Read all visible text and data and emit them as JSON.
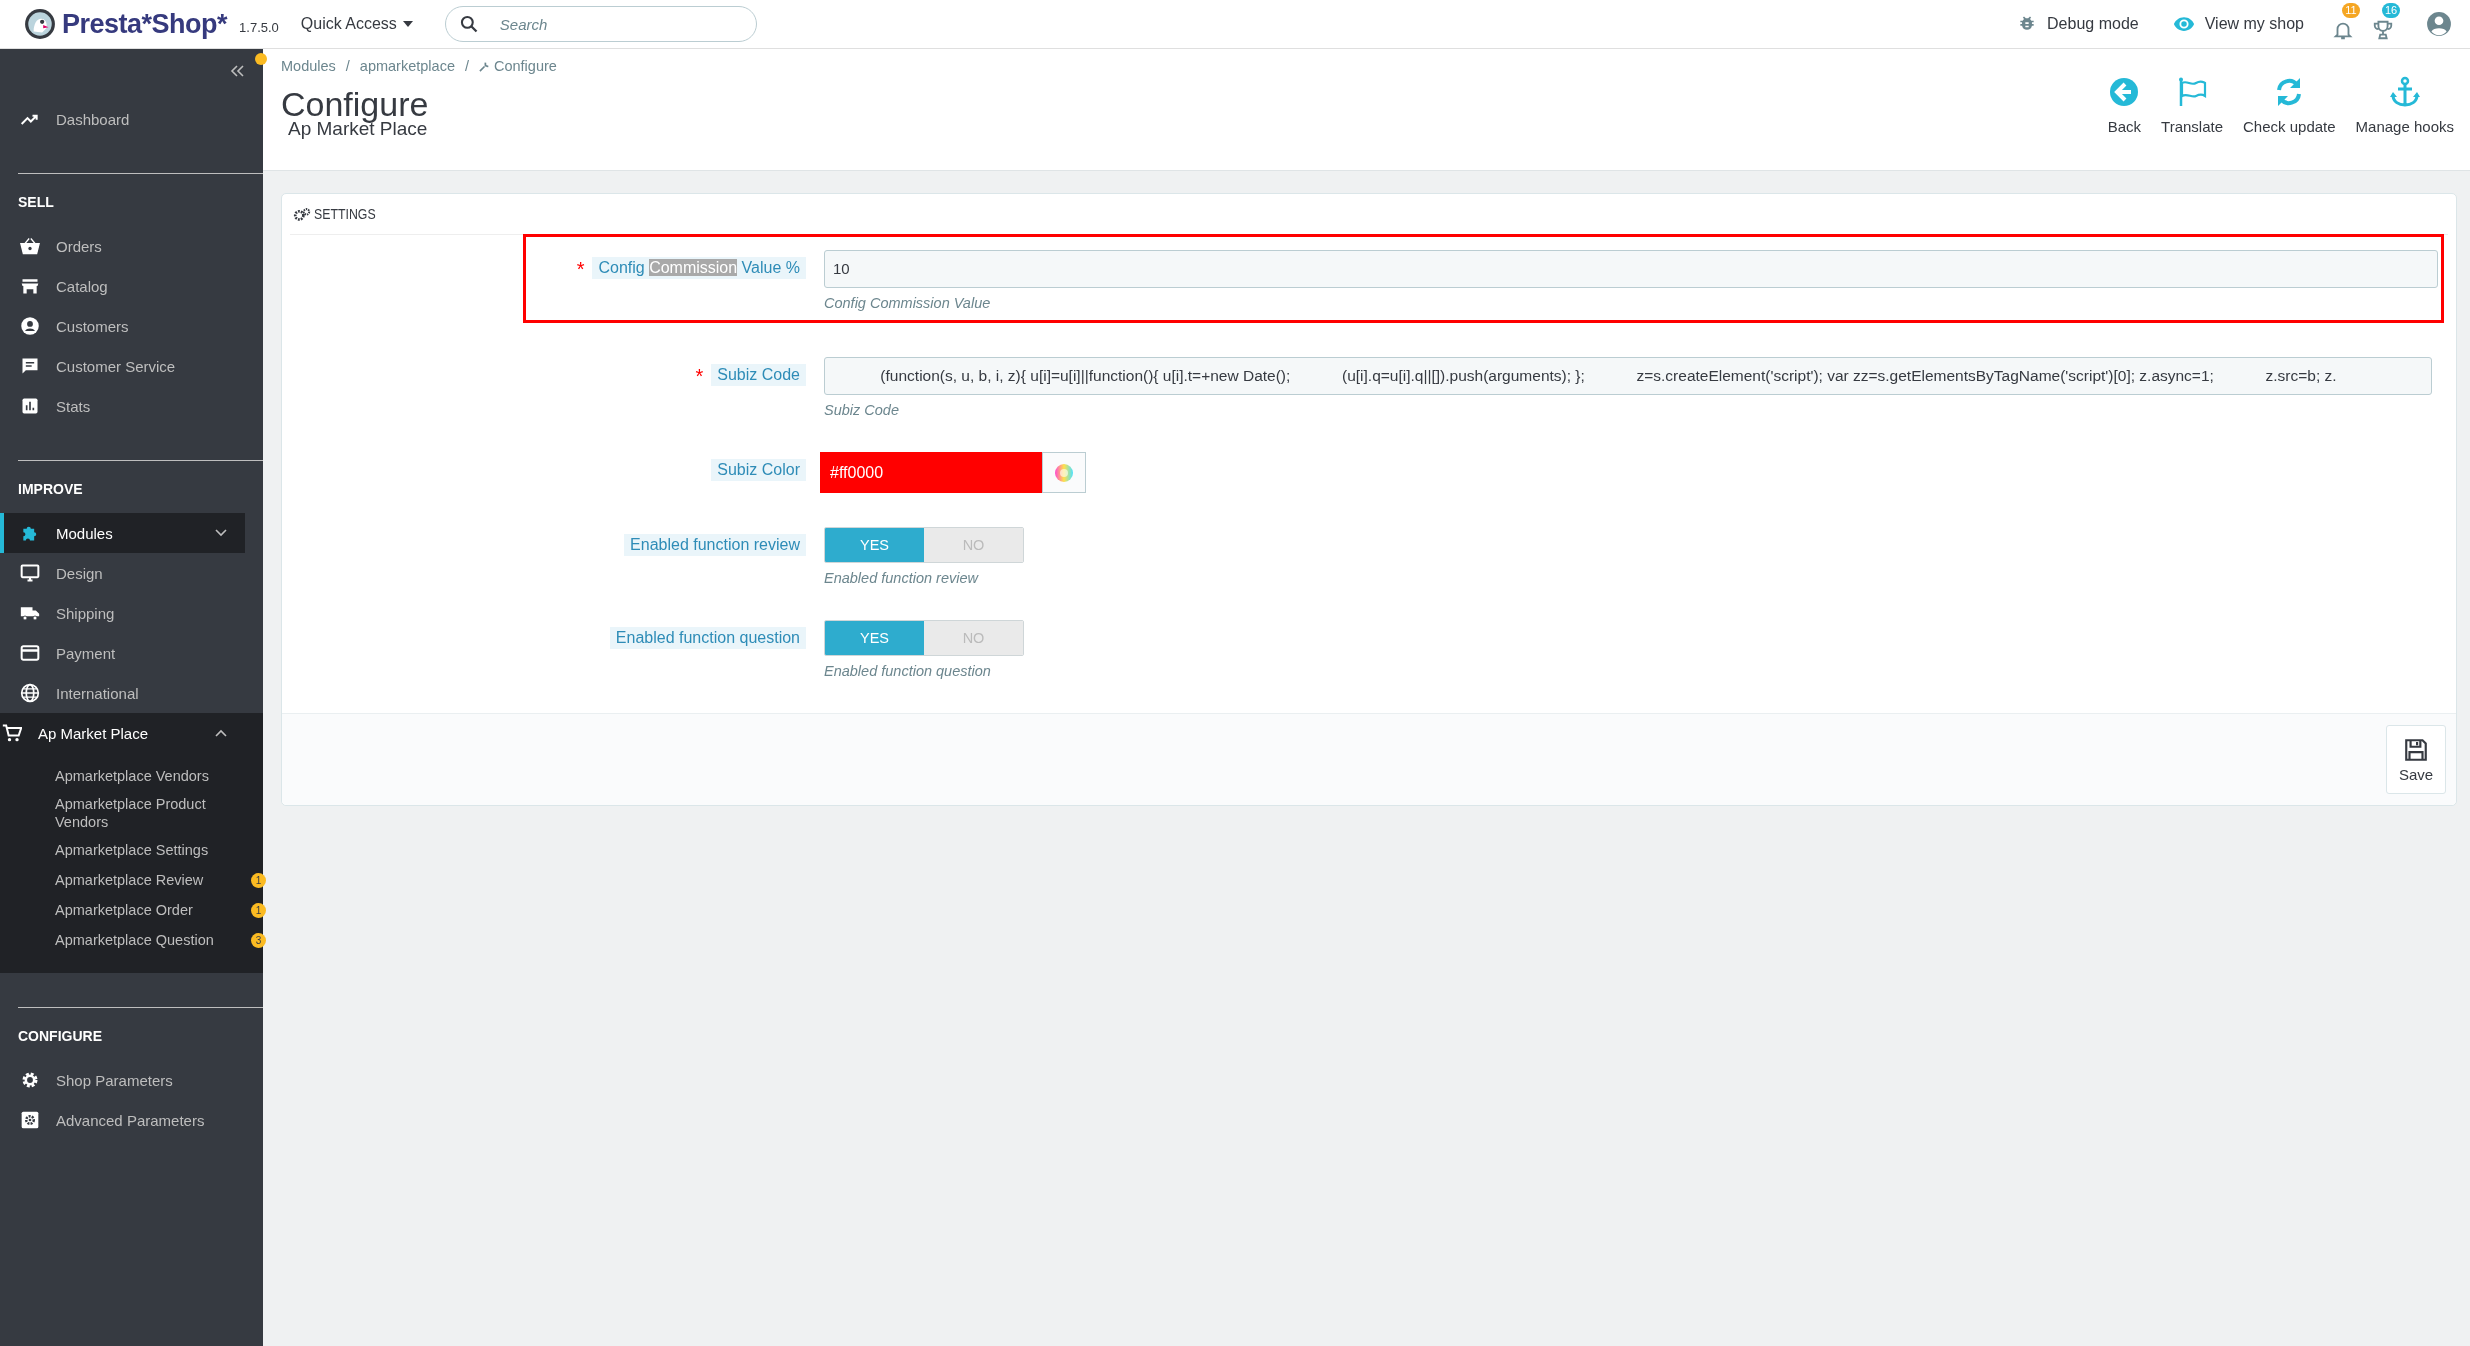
{
  "topbar": {
    "logo": "Presta*Shop*",
    "version": "1.7.5.0",
    "quick_access": "Quick Access",
    "search": {
      "placeholder": "Search"
    },
    "links": [
      {
        "label": "Debug mode"
      },
      {
        "label": "View my shop"
      }
    ],
    "notifications": [
      {
        "badge": "11",
        "color": "#f5a623"
      },
      {
        "badge": "16",
        "color": "#25b9d7"
      }
    ]
  },
  "sidebar": {
    "sections": [
      {
        "items": [
          {
            "label": "Dashboard",
            "selected": false
          }
        ]
      },
      {
        "heading": "SELL",
        "items": [
          {
            "label": "Orders",
            "selected": false
          },
          {
            "label": "Catalog",
            "selected": false
          },
          {
            "label": "Customers",
            "selected": false
          },
          {
            "label": "Customer Service",
            "selected": false
          },
          {
            "label": "Stats",
            "selected": false
          }
        ]
      },
      {
        "heading": "IMPROVE",
        "items": [
          {
            "label": "Modules",
            "selected": true,
            "expanded": false
          },
          {
            "label": "Design",
            "selected": false
          },
          {
            "label": "Shipping",
            "selected": false
          },
          {
            "label": "Payment",
            "selected": false
          },
          {
            "label": "International",
            "selected": false
          },
          {
            "label": "Ap Market Place",
            "selected": false,
            "expanded": true,
            "children": [
              {
                "label": "Apmarketplace Vendors",
                "selected": false
              },
              {
                "label": "Apmarketplace Product Vendors",
                "selected": false
              },
              {
                "label": "Apmarketplace Settings",
                "selected": false
              },
              {
                "label": "Apmarketplace Review",
                "selected": false,
                "badge": "1"
              },
              {
                "label": "Apmarketplace Order",
                "selected": false,
                "badge": "1"
              },
              {
                "label": "Apmarketplace Question",
                "selected": false,
                "badge": "3"
              }
            ]
          }
        ]
      },
      {
        "heading": "CONFIGURE",
        "items": [
          {
            "label": "Shop Parameters",
            "selected": false
          },
          {
            "label": "Advanced Parameters",
            "selected": false
          }
        ]
      }
    ]
  },
  "header": {
    "breadcrumb": [
      "Modules",
      "apmarketplace",
      "Configure"
    ],
    "separator": "/",
    "title": "Configure",
    "subtitle": "Ap Market Place",
    "toolbar": [
      {
        "label": "Back"
      },
      {
        "label": "Translate"
      },
      {
        "label": "Check update"
      },
      {
        "label": "Manage hooks"
      }
    ]
  },
  "panel": {
    "title": "SETTINGS",
    "save": "Save",
    "fields": [
      {
        "kind": "text",
        "required_mark": "*",
        "framed": true,
        "label_parts": [
          {
            "text": "Config ",
            "highlighted": false
          },
          {
            "text": "Commission",
            "highlighted": true
          },
          {
            "text": " Value %",
            "highlighted": false
          }
        ],
        "value": "10",
        "help": "Config Commission Value"
      },
      {
        "kind": "code",
        "required_mark": "*",
        "framed": false,
        "label_parts": [
          {
            "text": "Subiz Code",
            "highlighted": false
          }
        ],
        "value": "           (function(s, u, b, i, z){ u[i]=u[i]||function(){ u[i].t=+new Date();            (u[i].q=u[i].q||[]).push(arguments); };            z=s.createElement('script'); var zz=s.getElementsByTagName('script')[0]; z.async=1;            z.src=b; z.",
        "help": "Subiz Code"
      },
      {
        "kind": "color",
        "framed": false,
        "label_parts": [
          {
            "text": "Subiz Color",
            "highlighted": false
          }
        ],
        "value": "#ff0000",
        "color": "#ff0000"
      },
      {
        "kind": "switch",
        "framed": false,
        "label_parts": [
          {
            "text": "Enabled function review",
            "highlighted": false
          }
        ],
        "options": [
          {
            "label": "YES",
            "selected": true
          },
          {
            "label": "NO",
            "selected": false
          }
        ],
        "help": "Enabled function review"
      },
      {
        "kind": "switch",
        "framed": false,
        "label_parts": [
          {
            "text": "Enabled function question",
            "highlighted": false
          }
        ],
        "options": [
          {
            "label": "YES",
            "selected": true
          },
          {
            "label": "NO",
            "selected": false
          }
        ],
        "help": "Enabled function question"
      }
    ]
  }
}
